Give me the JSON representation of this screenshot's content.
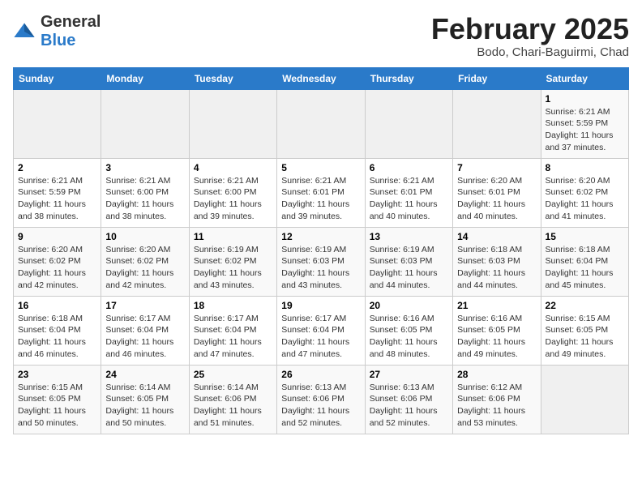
{
  "header": {
    "logo_general": "General",
    "logo_blue": "Blue",
    "month_year": "February 2025",
    "location": "Bodo, Chari-Baguirmi, Chad"
  },
  "weekdays": [
    "Sunday",
    "Monday",
    "Tuesday",
    "Wednesday",
    "Thursday",
    "Friday",
    "Saturday"
  ],
  "weeks": [
    [
      {
        "day": "",
        "info": ""
      },
      {
        "day": "",
        "info": ""
      },
      {
        "day": "",
        "info": ""
      },
      {
        "day": "",
        "info": ""
      },
      {
        "day": "",
        "info": ""
      },
      {
        "day": "",
        "info": ""
      },
      {
        "day": "1",
        "info": "Sunrise: 6:21 AM\nSunset: 5:59 PM\nDaylight: 11 hours\nand 37 minutes."
      }
    ],
    [
      {
        "day": "2",
        "info": "Sunrise: 6:21 AM\nSunset: 5:59 PM\nDaylight: 11 hours\nand 38 minutes."
      },
      {
        "day": "3",
        "info": "Sunrise: 6:21 AM\nSunset: 6:00 PM\nDaylight: 11 hours\nand 38 minutes."
      },
      {
        "day": "4",
        "info": "Sunrise: 6:21 AM\nSunset: 6:00 PM\nDaylight: 11 hours\nand 39 minutes."
      },
      {
        "day": "5",
        "info": "Sunrise: 6:21 AM\nSunset: 6:01 PM\nDaylight: 11 hours\nand 39 minutes."
      },
      {
        "day": "6",
        "info": "Sunrise: 6:21 AM\nSunset: 6:01 PM\nDaylight: 11 hours\nand 40 minutes."
      },
      {
        "day": "7",
        "info": "Sunrise: 6:20 AM\nSunset: 6:01 PM\nDaylight: 11 hours\nand 40 minutes."
      },
      {
        "day": "8",
        "info": "Sunrise: 6:20 AM\nSunset: 6:02 PM\nDaylight: 11 hours\nand 41 minutes."
      }
    ],
    [
      {
        "day": "9",
        "info": "Sunrise: 6:20 AM\nSunset: 6:02 PM\nDaylight: 11 hours\nand 42 minutes."
      },
      {
        "day": "10",
        "info": "Sunrise: 6:20 AM\nSunset: 6:02 PM\nDaylight: 11 hours\nand 42 minutes."
      },
      {
        "day": "11",
        "info": "Sunrise: 6:19 AM\nSunset: 6:02 PM\nDaylight: 11 hours\nand 43 minutes."
      },
      {
        "day": "12",
        "info": "Sunrise: 6:19 AM\nSunset: 6:03 PM\nDaylight: 11 hours\nand 43 minutes."
      },
      {
        "day": "13",
        "info": "Sunrise: 6:19 AM\nSunset: 6:03 PM\nDaylight: 11 hours\nand 44 minutes."
      },
      {
        "day": "14",
        "info": "Sunrise: 6:18 AM\nSunset: 6:03 PM\nDaylight: 11 hours\nand 44 minutes."
      },
      {
        "day": "15",
        "info": "Sunrise: 6:18 AM\nSunset: 6:04 PM\nDaylight: 11 hours\nand 45 minutes."
      }
    ],
    [
      {
        "day": "16",
        "info": "Sunrise: 6:18 AM\nSunset: 6:04 PM\nDaylight: 11 hours\nand 46 minutes."
      },
      {
        "day": "17",
        "info": "Sunrise: 6:17 AM\nSunset: 6:04 PM\nDaylight: 11 hours\nand 46 minutes."
      },
      {
        "day": "18",
        "info": "Sunrise: 6:17 AM\nSunset: 6:04 PM\nDaylight: 11 hours\nand 47 minutes."
      },
      {
        "day": "19",
        "info": "Sunrise: 6:17 AM\nSunset: 6:04 PM\nDaylight: 11 hours\nand 47 minutes."
      },
      {
        "day": "20",
        "info": "Sunrise: 6:16 AM\nSunset: 6:05 PM\nDaylight: 11 hours\nand 48 minutes."
      },
      {
        "day": "21",
        "info": "Sunrise: 6:16 AM\nSunset: 6:05 PM\nDaylight: 11 hours\nand 49 minutes."
      },
      {
        "day": "22",
        "info": "Sunrise: 6:15 AM\nSunset: 6:05 PM\nDaylight: 11 hours\nand 49 minutes."
      }
    ],
    [
      {
        "day": "23",
        "info": "Sunrise: 6:15 AM\nSunset: 6:05 PM\nDaylight: 11 hours\nand 50 minutes."
      },
      {
        "day": "24",
        "info": "Sunrise: 6:14 AM\nSunset: 6:05 PM\nDaylight: 11 hours\nand 50 minutes."
      },
      {
        "day": "25",
        "info": "Sunrise: 6:14 AM\nSunset: 6:06 PM\nDaylight: 11 hours\nand 51 minutes."
      },
      {
        "day": "26",
        "info": "Sunrise: 6:13 AM\nSunset: 6:06 PM\nDaylight: 11 hours\nand 52 minutes."
      },
      {
        "day": "27",
        "info": "Sunrise: 6:13 AM\nSunset: 6:06 PM\nDaylight: 11 hours\nand 52 minutes."
      },
      {
        "day": "28",
        "info": "Sunrise: 6:12 AM\nSunset: 6:06 PM\nDaylight: 11 hours\nand 53 minutes."
      },
      {
        "day": "",
        "info": ""
      }
    ]
  ]
}
